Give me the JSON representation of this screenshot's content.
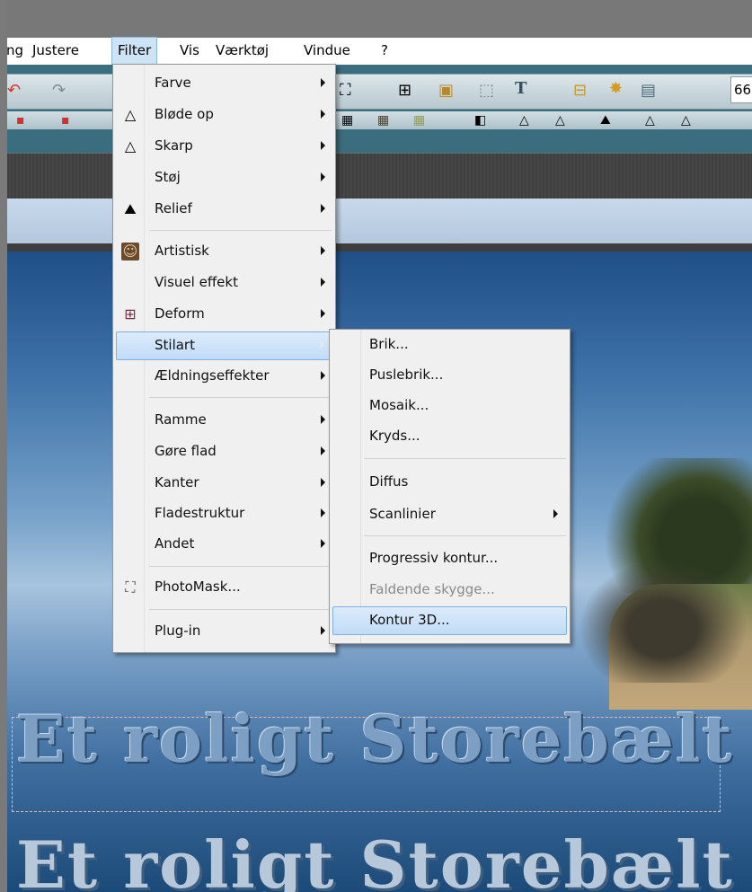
{
  "menubar": {
    "items": [
      "ng",
      "Justere",
      "Filter",
      "Vis",
      "Værktøj",
      "Vindue",
      "?"
    ]
  },
  "toolbar": {
    "zoom_value": "66"
  },
  "filter_menu": {
    "items": [
      {
        "label": "Farve",
        "icon": "",
        "submenu": true
      },
      {
        "label": "Bløde op",
        "icon": "drop-icon",
        "submenu": true
      },
      {
        "label": "Skarp",
        "icon": "triangle-icon",
        "submenu": true
      },
      {
        "label": "Støj",
        "icon": "",
        "submenu": true
      },
      {
        "label": "Relief",
        "icon": "relief-icon",
        "submenu": true
      },
      {
        "label": "Artistisk",
        "icon": "portrait-icon",
        "submenu": true
      },
      {
        "label": "Visuel effekt",
        "icon": "",
        "submenu": true
      },
      {
        "label": "Deform",
        "icon": "grid-icon",
        "submenu": true
      },
      {
        "label": "Stilart",
        "icon": "",
        "submenu": true
      },
      {
        "label": "Ældningseffekter",
        "icon": "",
        "submenu": true
      },
      {
        "label": "Ramme",
        "icon": "",
        "submenu": true
      },
      {
        "label": "Gøre flad",
        "icon": "",
        "submenu": true
      },
      {
        "label": "Kanter",
        "icon": "",
        "submenu": true
      },
      {
        "label": "Fladestruktur",
        "icon": "",
        "submenu": true
      },
      {
        "label": "Andet",
        "icon": "",
        "submenu": true
      },
      {
        "label": "PhotoMask...",
        "icon": "photomask-icon",
        "submenu": false
      },
      {
        "label": "Plug-in",
        "icon": "",
        "submenu": true
      }
    ]
  },
  "stilart_menu": {
    "items": [
      {
        "label": "Brik..."
      },
      {
        "label": "Puslebrik..."
      },
      {
        "label": "Mosaik..."
      },
      {
        "label": "Kryds..."
      },
      {
        "label": "Diffus"
      },
      {
        "label": "Scanlinier"
      },
      {
        "label": "Progressiv kontur..."
      },
      {
        "label": "Faldende skygge..."
      },
      {
        "label": "Kontur 3D..."
      }
    ]
  },
  "canvas": {
    "text_line_1": "Et roligt Storebælt",
    "text_line_2": "Et roligt Storebælt"
  }
}
